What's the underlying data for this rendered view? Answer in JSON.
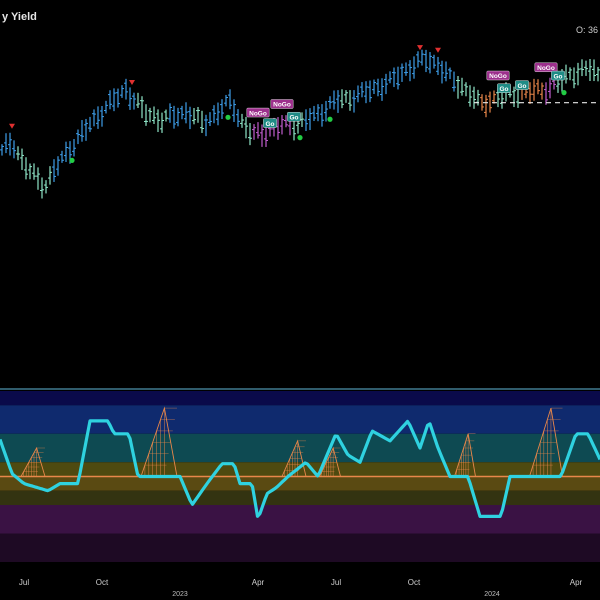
{
  "colors": {
    "background": "#000000",
    "strong_go": "#3e9ee8",
    "weak_go": "#8fe6c8",
    "strong_nogo": "#c15ecf",
    "weak_nogo": "#e8874a",
    "oscillator": "#2fd2e0",
    "zero_line": "#e8874a",
    "marker_down": "#e03030",
    "marker_dot": "#22cc44",
    "nogo_label_bg": "#9c2f8c",
    "go_label_bg": "#1f8c86",
    "panel_border": "#5fb7d8"
  },
  "chart_data": [
    {
      "type": "bar",
      "title": "y Yield",
      "readout": "O: 36",
      "x_ticks": [
        {
          "label": "Jul",
          "t": 0.04
        },
        {
          "label": "Oct",
          "t": 0.17
        },
        {
          "label": "2023",
          "t": 0.3,
          "year": true
        },
        {
          "label": "Apr",
          "t": 0.43
        },
        {
          "label": "Jul",
          "t": 0.56
        },
        {
          "label": "Oct",
          "t": 0.69
        },
        {
          "label": "2024",
          "t": 0.82,
          "year": true
        },
        {
          "label": "Apr",
          "t": 0.96
        }
      ],
      "ylim": [
        0,
        100
      ],
      "series_keypoints": [
        [
          0.0,
          40
        ],
        [
          0.02,
          47
        ],
        [
          0.04,
          34
        ],
        [
          0.075,
          23
        ],
        [
          0.1,
          36
        ],
        [
          0.14,
          52
        ],
        [
          0.175,
          64
        ],
        [
          0.21,
          74
        ],
        [
          0.24,
          62
        ],
        [
          0.27,
          58
        ],
        [
          0.31,
          62
        ],
        [
          0.34,
          56
        ],
        [
          0.37,
          64
        ],
        [
          0.385,
          68
        ],
        [
          0.4,
          58
        ],
        [
          0.42,
          50
        ],
        [
          0.44,
          51
        ],
        [
          0.47,
          55
        ],
        [
          0.5,
          56
        ],
        [
          0.53,
          61
        ],
        [
          0.56,
          68
        ],
        [
          0.59,
          70
        ],
        [
          0.62,
          74
        ],
        [
          0.65,
          78
        ],
        [
          0.68,
          85
        ],
        [
          0.71,
          90
        ],
        [
          0.73,
          87
        ],
        [
          0.75,
          80
        ],
        [
          0.78,
          73
        ],
        [
          0.8,
          66
        ],
        [
          0.83,
          70
        ],
        [
          0.86,
          72
        ],
        [
          0.89,
          73
        ],
        [
          0.92,
          75
        ],
        [
          0.95,
          82
        ],
        [
          0.985,
          85
        ],
        [
          1.0,
          80
        ]
      ],
      "regimes": [
        [
          0.0,
          0.03,
          "strong_go"
        ],
        [
          0.03,
          0.09,
          "weak_go"
        ],
        [
          0.09,
          0.23,
          "strong_go"
        ],
        [
          0.23,
          0.28,
          "weak_go"
        ],
        [
          0.28,
          0.32,
          "strong_go"
        ],
        [
          0.32,
          0.34,
          "weak_go"
        ],
        [
          0.34,
          0.4,
          "strong_go"
        ],
        [
          0.4,
          0.42,
          "weak_go"
        ],
        [
          0.42,
          0.49,
          "strong_nogo"
        ],
        [
          0.49,
          0.51,
          "weak_go"
        ],
        [
          0.51,
          0.57,
          "strong_go"
        ],
        [
          0.57,
          0.59,
          "weak_go"
        ],
        [
          0.59,
          0.76,
          "strong_go"
        ],
        [
          0.76,
          0.8,
          "weak_go"
        ],
        [
          0.8,
          0.83,
          "weak_nogo"
        ],
        [
          0.83,
          0.87,
          "weak_go"
        ],
        [
          0.87,
          0.91,
          "weak_nogo"
        ],
        [
          0.91,
          0.93,
          "strong_nogo"
        ],
        [
          0.93,
          1.0,
          "weak_go"
        ]
      ],
      "reference_level": 67,
      "reference_range": [
        0.79,
        1.0
      ],
      "down_markers": [
        0.02,
        0.22,
        0.7,
        0.73
      ],
      "dots": [
        0.12,
        0.38,
        0.5,
        0.55,
        0.94
      ],
      "signal_labels": [
        {
          "text": "NoGo",
          "t": 0.43,
          "row": 0
        },
        {
          "text": "NoGo",
          "t": 0.47,
          "row": 0
        },
        {
          "text": "Go",
          "t": 0.45,
          "row": 1
        },
        {
          "text": "Go",
          "t": 0.49,
          "row": 1
        },
        {
          "text": "NoGo",
          "t": 0.83,
          "row": 0
        },
        {
          "text": "Go",
          "t": 0.84,
          "row": 1
        },
        {
          "text": "Go",
          "t": 0.87,
          "row": 1
        },
        {
          "text": "NoGo",
          "t": 0.91,
          "row": 0
        },
        {
          "text": "Go",
          "t": 0.93,
          "row": 1
        }
      ]
    },
    {
      "type": "line",
      "ylim": [
        -6,
        6
      ],
      "zero_level": 0,
      "bands": [
        [
          5,
          6,
          "#0a0a4a"
        ],
        [
          3,
          5,
          "#0f2a6e"
        ],
        [
          1,
          3,
          "#0e4a52"
        ],
        [
          0,
          1,
          "#4e4a10"
        ],
        [
          -1,
          0,
          "#5a4a12"
        ],
        [
          -2,
          -1,
          "#333311"
        ],
        [
          -4,
          -2,
          "#3a1244"
        ],
        [
          -6,
          -4,
          "#1e0a24"
        ]
      ],
      "oscillator_keypoints": [
        [
          0.0,
          2.6
        ],
        [
          0.02,
          0.2
        ],
        [
          0.04,
          -0.5
        ],
        [
          0.08,
          -1.0
        ],
        [
          0.1,
          -0.5
        ],
        [
          0.13,
          -0.5
        ],
        [
          0.15,
          3.9
        ],
        [
          0.18,
          3.9
        ],
        [
          0.19,
          3.0
        ],
        [
          0.215,
          3.0
        ],
        [
          0.23,
          0.0
        ],
        [
          0.3,
          0.0
        ],
        [
          0.32,
          -2.0
        ],
        [
          0.345,
          -0.5
        ],
        [
          0.37,
          0.9
        ],
        [
          0.39,
          0.9
        ],
        [
          0.4,
          -0.5
        ],
        [
          0.42,
          -0.5
        ],
        [
          0.43,
          -3.0
        ],
        [
          0.445,
          -1.2
        ],
        [
          0.46,
          -0.8
        ],
        [
          0.48,
          0.0
        ],
        [
          0.51,
          1.0
        ],
        [
          0.53,
          0.0
        ],
        [
          0.56,
          3.0
        ],
        [
          0.58,
          1.5
        ],
        [
          0.6,
          1.0
        ],
        [
          0.62,
          3.2
        ],
        [
          0.65,
          2.5
        ],
        [
          0.68,
          3.9
        ],
        [
          0.7,
          2.0
        ],
        [
          0.715,
          3.9
        ],
        [
          0.73,
          2.0
        ],
        [
          0.75,
          0.0
        ],
        [
          0.78,
          0.0
        ],
        [
          0.8,
          -2.8
        ],
        [
          0.835,
          -2.8
        ],
        [
          0.85,
          0.0
        ],
        [
          0.935,
          0.0
        ],
        [
          0.96,
          3.0
        ],
        [
          0.98,
          3.0
        ],
        [
          1.0,
          1.2
        ]
      ],
      "shadow_spikes": [
        {
          "t": 0.055,
          "w": 0.04,
          "peak": 2.0
        },
        {
          "t": 0.265,
          "w": 0.06,
          "peak": 4.8
        },
        {
          "t": 0.49,
          "w": 0.04,
          "peak": 2.5
        },
        {
          "t": 0.55,
          "w": 0.035,
          "peak": 2.0
        },
        {
          "t": 0.775,
          "w": 0.035,
          "peak": 3.0
        },
        {
          "t": 0.91,
          "w": 0.055,
          "peak": 4.8
        }
      ]
    }
  ]
}
